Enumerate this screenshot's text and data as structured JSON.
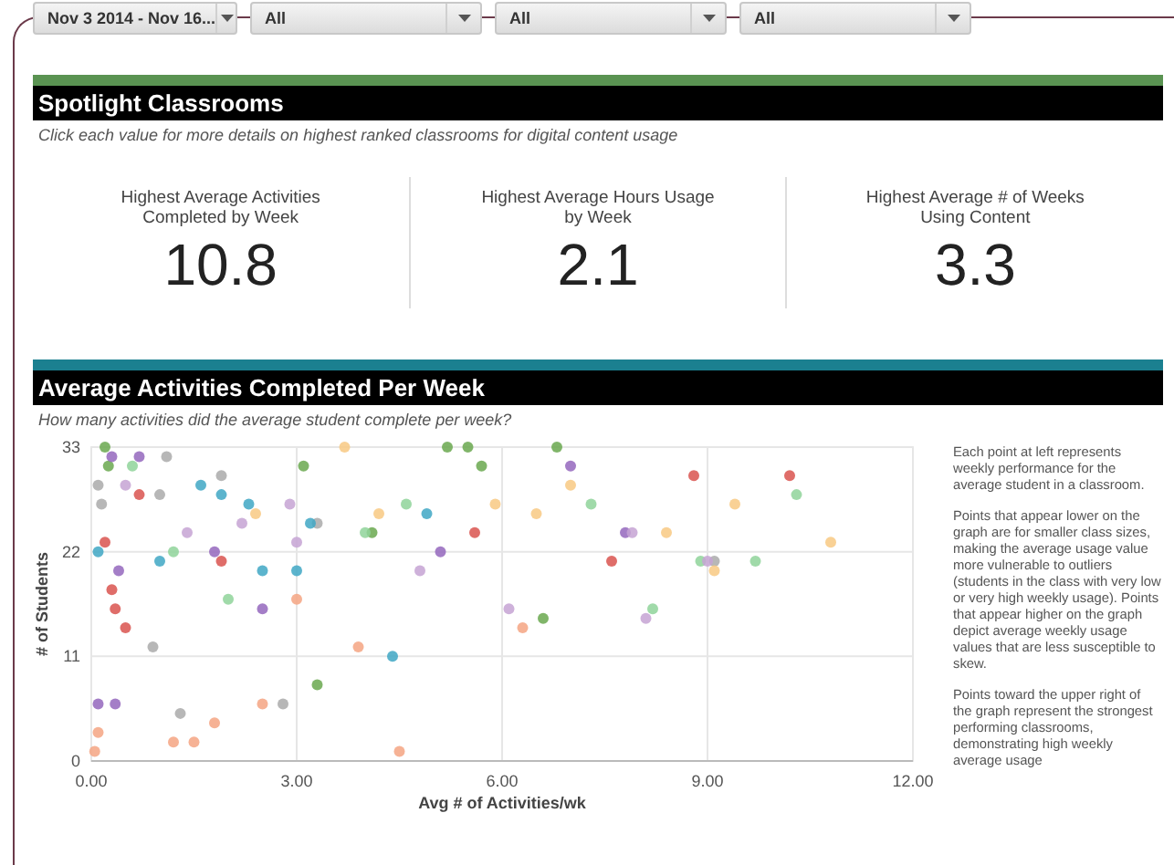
{
  "filters": [
    {
      "value": "Nov 3 2014 - Nov 16..."
    },
    {
      "value": "All"
    },
    {
      "value": "All"
    },
    {
      "value": "All"
    }
  ],
  "spotlight": {
    "title": "Spotlight Classrooms",
    "subtitle": "Click each value for more details on highest ranked classrooms for digital content usage",
    "metrics": [
      {
        "label": "Highest Average Activities Completed by Week",
        "value": "10.8"
      },
      {
        "label": "Highest Average Hours Usage by Week",
        "value": "2.1"
      },
      {
        "label": "Highest Average # of Weeks Using Content",
        "value": "3.3"
      }
    ]
  },
  "activities": {
    "title": "Average Activities Completed Per Week",
    "subtitle": "How many activities did the average student complete per week?",
    "chart_data": {
      "type": "scatter",
      "grid": true,
      "xlabel": "Avg # of Activities/wk",
      "ylabel": "# of Students",
      "xlim": [
        0,
        12
      ],
      "ylim": [
        0,
        33
      ],
      "xticks": [
        {
          "value": 0,
          "label": "0.00"
        },
        {
          "value": 3,
          "label": "3.00"
        },
        {
          "value": 6,
          "label": "6.00"
        },
        {
          "value": 9,
          "label": "9.00"
        },
        {
          "value": 12,
          "label": "12.00"
        }
      ],
      "yticks": [
        0,
        11,
        22,
        33
      ],
      "series": [
        {
          "color": "#6aa84f",
          "x": [
            0.2,
            0.25,
            3.1,
            5.2,
            5.5,
            5.7,
            6.8,
            6.6,
            3.3,
            4.1
          ],
          "values": [
            33,
            31,
            31,
            33,
            33,
            31,
            33,
            15,
            8,
            24
          ]
        },
        {
          "color": "#9467bd",
          "x": [
            0.3,
            0.7,
            0.1,
            0.35,
            0.4,
            1.8,
            2.5,
            5.1,
            7.0,
            7.8
          ],
          "values": [
            32,
            32,
            6,
            6,
            20,
            22,
            16,
            22,
            31,
            24
          ]
        },
        {
          "color": "#aaaaaa",
          "x": [
            0.1,
            0.15,
            1.1,
            1.9,
            1.0,
            0.9,
            1.3,
            2.8,
            3.3,
            9.1
          ],
          "values": [
            29,
            27,
            32,
            30,
            28,
            12,
            5,
            6,
            25,
            21
          ]
        },
        {
          "color": "#3fa7c4",
          "x": [
            0.1,
            1.0,
            1.6,
            1.9,
            2.3,
            3.0,
            3.2,
            4.4,
            4.9,
            2.5
          ],
          "values": [
            22,
            21,
            29,
            28,
            27,
            20,
            25,
            11,
            26,
            20
          ]
        },
        {
          "color": "#d9534f",
          "x": [
            0.2,
            0.3,
            0.35,
            0.5,
            0.7,
            1.9,
            5.6,
            7.6,
            8.8,
            10.2
          ],
          "values": [
            23,
            18,
            16,
            14,
            28,
            21,
            24,
            21,
            30,
            30
          ]
        },
        {
          "color": "#f4a582",
          "x": [
            0.05,
            0.1,
            1.2,
            1.5,
            1.8,
            2.5,
            3.0,
            4.5,
            6.3,
            3.9
          ],
          "values": [
            1,
            3,
            2,
            2,
            4,
            6,
            17,
            1,
            14,
            12
          ]
        },
        {
          "color": "#f8c983",
          "x": [
            3.7,
            4.2,
            5.9,
            6.5,
            7.0,
            8.4,
            9.4,
            10.8,
            9.1,
            2.4
          ],
          "values": [
            33,
            26,
            27,
            26,
            29,
            24,
            27,
            23,
            20,
            26
          ]
        },
        {
          "color": "#8fd39a",
          "x": [
            0.6,
            1.2,
            2.0,
            4.0,
            4.6,
            7.3,
            8.2,
            8.9,
            9.7,
            10.3
          ],
          "values": [
            31,
            22,
            17,
            24,
            27,
            27,
            16,
            21,
            21,
            28
          ]
        },
        {
          "color": "#c5a3d4",
          "x": [
            0.5,
            1.4,
            2.2,
            3.0,
            6.1,
            7.9,
            8.1,
            9.0,
            2.9,
            4.8
          ],
          "values": [
            29,
            24,
            25,
            23,
            16,
            24,
            15,
            21,
            27,
            20
          ]
        }
      ]
    },
    "notes": [
      "Each point at left represents weekly performance for the average student in a classroom.",
      "Points that appear lower on the graph are for smaller class sizes, making the average usage value more vulnerable to outliers (students in the class with very low or very high weekly usage).  Points that appear higher on the graph depict average weekly usage values that are less susceptible to skew.",
      "Points toward the upper right of the graph represent the strongest performing classrooms, demonstrating high weekly average usage"
    ]
  }
}
